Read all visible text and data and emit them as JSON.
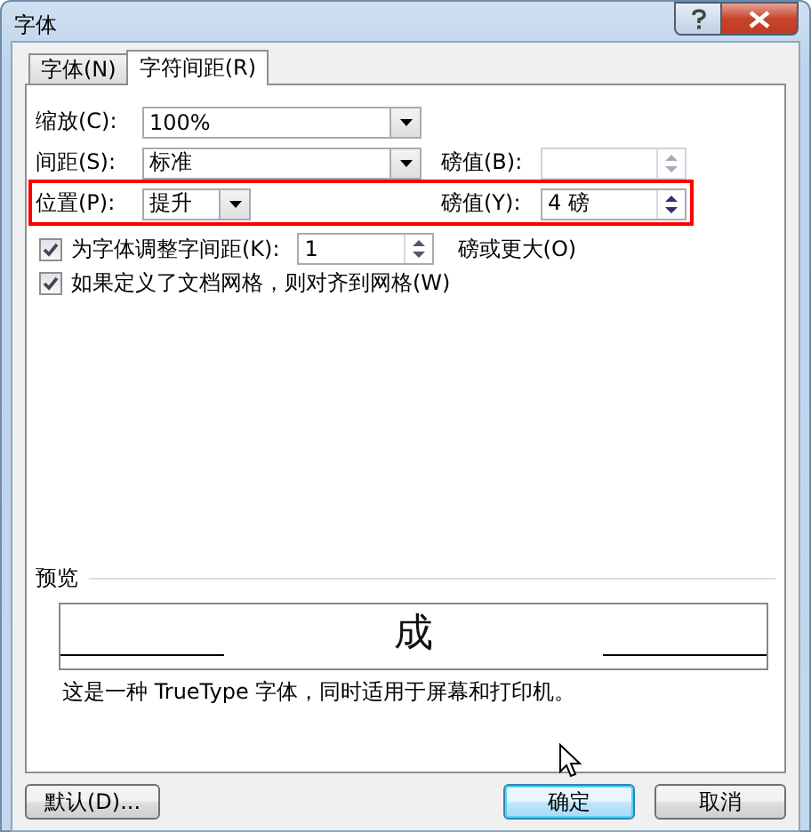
{
  "window": {
    "title": "字体"
  },
  "tabs": [
    {
      "label": "字体(N)",
      "selected": false
    },
    {
      "label": "字符间距(R)",
      "selected": true
    }
  ],
  "scale": {
    "label": "缩放(C):",
    "value": "100%"
  },
  "spacing": {
    "label": "间距(S):",
    "value": "标准",
    "points_label": "磅值(B):"
  },
  "position": {
    "label": "位置(P):",
    "value": "提升",
    "points_label": "磅值(Y):",
    "points_value": "4 磅"
  },
  "kerning": {
    "label": "为字体调整字间距(K):",
    "checked": true,
    "value": "1",
    "suffix": "磅或更大(O)"
  },
  "snap_to_grid": {
    "label": "如果定义了文档网格，则对齐到网格(W)",
    "checked": true
  },
  "preview": {
    "label": "预览",
    "sample": "成",
    "description": "这是一种 TrueType 字体，同时适用于屏幕和打印机。"
  },
  "buttons": [
    {
      "label": "默认(D)...",
      "kind": "default"
    },
    {
      "label": "确定",
      "kind": "primary"
    },
    {
      "label": "取消",
      "kind": "normal"
    }
  ]
}
